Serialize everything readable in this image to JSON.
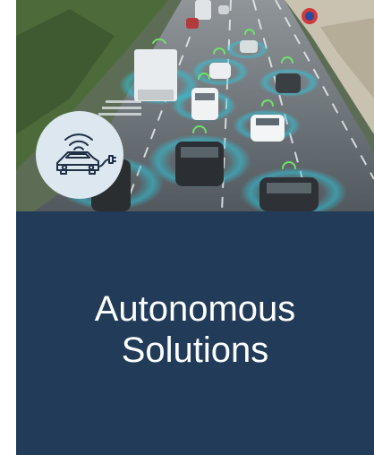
{
  "card": {
    "title_line1": "Autonomous",
    "title_line2": "Solutions",
    "panel_color": "#213b58",
    "text_color": "#ffffff"
  },
  "hero": {
    "subject": "connected cars on highway with signal rings",
    "badge_icon": "connected-car-icon",
    "badge_color": "#dde7ef"
  }
}
